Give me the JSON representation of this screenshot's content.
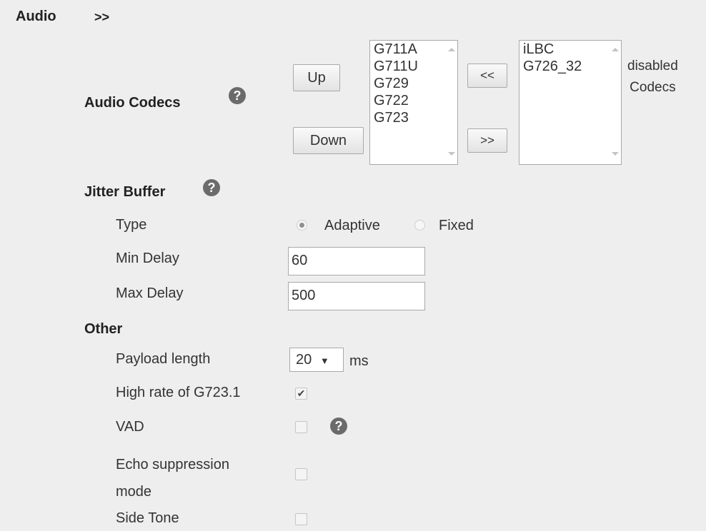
{
  "section": {
    "title": "Audio",
    "toggle": ">>"
  },
  "audio_codecs": {
    "label": "Audio Codecs",
    "up_button": "Up",
    "down_button": "Down",
    "move_left_button": "<<",
    "move_right_button": ">>",
    "enabled_list": [
      "G711A",
      "G711U",
      "G729",
      "G722",
      "G723"
    ],
    "disabled_list": [
      "iLBC",
      "G726_32"
    ],
    "disabled_label_line1": "disabled",
    "disabled_label_line2": "Codecs"
  },
  "jitter_buffer": {
    "title": "Jitter Buffer",
    "type_label": "Type",
    "type_options": [
      "Adaptive",
      "Fixed"
    ],
    "type_selected": "Adaptive",
    "min_delay_label": "Min Delay",
    "min_delay_value": "60",
    "max_delay_label": "Max Delay",
    "max_delay_value": "500"
  },
  "other": {
    "title": "Other",
    "payload_length_label": "Payload length",
    "payload_length_value": "20",
    "payload_length_unit": "ms",
    "high_rate_label": "High rate of G723.1",
    "high_rate_checked": true,
    "vad_label": "VAD",
    "vad_checked": false,
    "echo_label_line1": "Echo suppression",
    "echo_label_line2": "mode",
    "echo_checked": false,
    "side_tone_label": "Side Tone",
    "side_tone_checked": false
  },
  "icons": {
    "help": "question-circle-icon",
    "dropdown": "triangle-down-icon",
    "check": "checkmark-icon"
  },
  "colors": {
    "panel_background": "#eeeeee",
    "help_icon": "#6b6b6b",
    "border": "#a9a9a9"
  }
}
